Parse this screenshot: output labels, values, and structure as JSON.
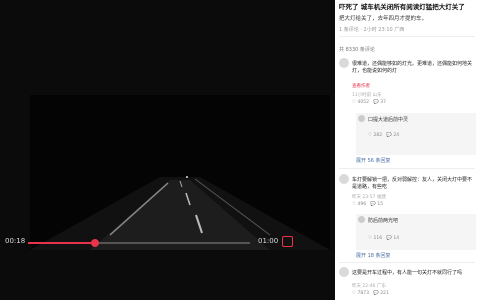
{
  "player": {
    "current_time": "00:18",
    "duration": "01:00",
    "progress": 0.3
  },
  "post": {
    "title": "吓死了 城车机关闭所有阅读灯猛把大灯关了",
    "desc": "把大灯给关了，去年四月才提的车，",
    "meta": "1 条评论 · 2小时 23:10 广西",
    "comment_count": "共 8330 条评论"
  },
  "comments": [
    {
      "text": "很难道，还偶能够如的灯光。更难道，还偶能如何地关灯，也能说如何的灯",
      "tag": "查看作者",
      "meta": "11小时前 山东",
      "likes": "4052",
      "replies": "37",
      "reply_text": "口提大道后前中灵",
      "reply_meta_a": "282",
      "reply_meta_b": "24",
      "expand": "展开 56 条回复"
    },
    {
      "text": "车灯要解锁一把，反对弱解控：友人，关闭大灯中要不是道路，有些吃",
      "meta": "昨天 23:57 福建",
      "likes": "496",
      "replies": "15",
      "reply_text": "防后前两光吧",
      "reply_meta_a": "116",
      "reply_meta_b": "14",
      "expand": "展开 18 条回复"
    },
    {
      "text": "这要是开车过程中，有人能一句关灯不就同行了吗",
      "meta": "昨天 22:46 广东",
      "likes": "7873",
      "replies": "221"
    }
  ]
}
